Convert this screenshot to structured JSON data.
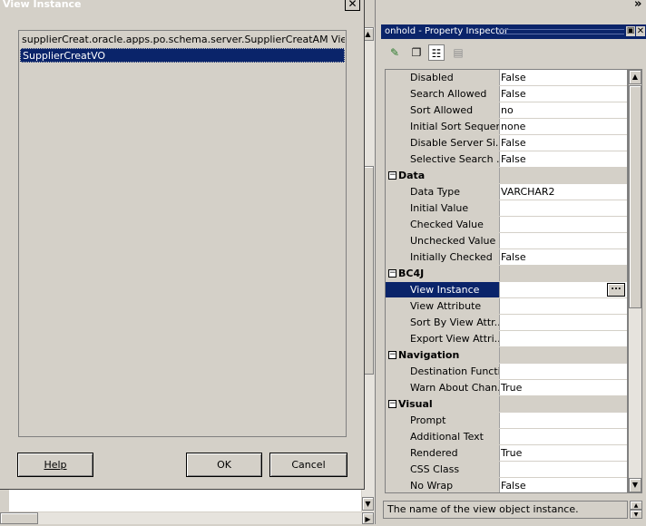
{
  "dialog": {
    "title": "View Instance",
    "close_label": "✕",
    "list_items": [
      "supplierCreat.oracle.apps.po.schema.server.SupplierCreatAM View Ins...",
      "SupplierCreatVO"
    ],
    "selected_index": 1,
    "help_label": "Help",
    "ok_label": "OK",
    "cancel_label": "Cancel"
  },
  "background": {
    "chevron": "»"
  },
  "inspector": {
    "title": "onhold - Property Inspector",
    "status_text": "The name of the view object instance.",
    "rows": [
      {
        "type": "prop",
        "name": "Disabled",
        "value": "False"
      },
      {
        "type": "prop",
        "name": "Search Allowed",
        "value": "False"
      },
      {
        "type": "prop",
        "name": "Sort Allowed",
        "value": "no"
      },
      {
        "type": "prop",
        "name": "Initial Sort Sequen...",
        "value": "none"
      },
      {
        "type": "prop",
        "name": "Disable Server Si...",
        "value": "False"
      },
      {
        "type": "prop",
        "name": "Selective Search ...",
        "value": "False"
      },
      {
        "type": "cat",
        "name": "Data",
        "value": ""
      },
      {
        "type": "prop",
        "name": "Data Type",
        "value": "VARCHAR2"
      },
      {
        "type": "prop",
        "name": "Initial Value",
        "value": ""
      },
      {
        "type": "prop",
        "name": "Checked Value",
        "value": ""
      },
      {
        "type": "prop",
        "name": "Unchecked Value",
        "value": ""
      },
      {
        "type": "prop",
        "name": "Initially Checked",
        "value": "False"
      },
      {
        "type": "cat",
        "name": "BC4J",
        "value": ""
      },
      {
        "type": "prop",
        "name": "View Instance",
        "value": "",
        "selected": true
      },
      {
        "type": "prop",
        "name": "View Attribute",
        "value": ""
      },
      {
        "type": "prop",
        "name": "Sort By View Attr...",
        "value": ""
      },
      {
        "type": "prop",
        "name": "Export View Attri...",
        "value": ""
      },
      {
        "type": "cat",
        "name": "Navigation",
        "value": ""
      },
      {
        "type": "prop",
        "name": "Destination Functi...",
        "value": ""
      },
      {
        "type": "prop",
        "name": "Warn About Chan...",
        "value": "True"
      },
      {
        "type": "cat",
        "name": "Visual",
        "value": ""
      },
      {
        "type": "prop",
        "name": "Prompt",
        "value": ""
      },
      {
        "type": "prop",
        "name": "Additional Text",
        "value": ""
      },
      {
        "type": "prop",
        "name": "Rendered",
        "value": "True"
      },
      {
        "type": "prop",
        "name": "CSS Class",
        "value": ""
      },
      {
        "type": "prop",
        "name": "No Wrap",
        "value": "False"
      }
    ]
  },
  "colors": {
    "face": "#d4d0c8",
    "selection": "#0a246a",
    "white": "#ffffff"
  }
}
